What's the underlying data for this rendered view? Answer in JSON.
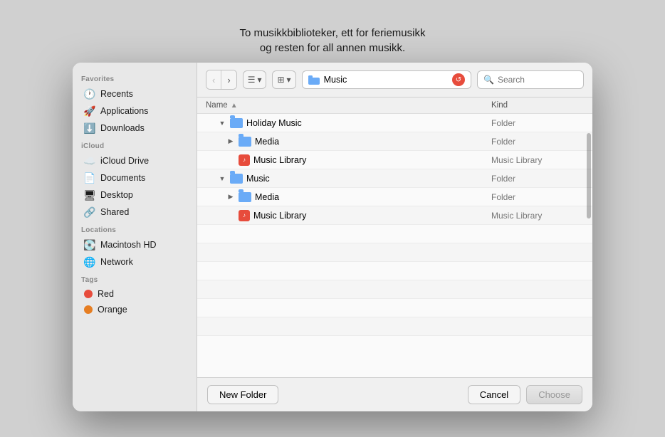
{
  "tooltip": {
    "line1": "To musikkbiblioteker, ett for feriemusikk",
    "line2": "og resten for all annen musikk."
  },
  "sidebar": {
    "favorites_label": "Favorites",
    "icloud_label": "iCloud",
    "locations_label": "Locations",
    "tags_label": "Tags",
    "favorites": [
      {
        "id": "recents",
        "label": "Recents",
        "icon": "🕐",
        "icon_class": "icon-red"
      },
      {
        "id": "applications",
        "label": "Applications",
        "icon": "🚀",
        "icon_class": "icon-red"
      },
      {
        "id": "downloads",
        "label": "Downloads",
        "icon": "⬇️",
        "icon_class": "icon-red"
      }
    ],
    "icloud": [
      {
        "id": "icloud-drive",
        "label": "iCloud Drive",
        "icon": "☁️"
      },
      {
        "id": "documents",
        "label": "Documents",
        "icon": "📄"
      },
      {
        "id": "desktop",
        "label": "Desktop",
        "icon": "🖥"
      },
      {
        "id": "shared",
        "label": "Shared",
        "icon": "🔗"
      }
    ],
    "locations": [
      {
        "id": "macintosh-hd",
        "label": "Macintosh HD",
        "icon": "💽"
      },
      {
        "id": "network",
        "label": "Network",
        "icon": "🌐"
      }
    ],
    "tags": [
      {
        "id": "red",
        "label": "Red",
        "color": "#e74c3c"
      },
      {
        "id": "orange",
        "label": "Orange",
        "color": "#e67e22"
      }
    ]
  },
  "toolbar": {
    "path_name": "Music",
    "search_placeholder": "Search"
  },
  "file_list": {
    "col_name": "Name",
    "col_kind": "Kind",
    "rows": [
      {
        "id": "holiday-music",
        "name": "Holiday Music",
        "kind": "Folder",
        "type": "folder",
        "indent": 0,
        "expanded": true,
        "expand": "▼"
      },
      {
        "id": "holiday-media",
        "name": "Media",
        "kind": "Folder",
        "type": "folder",
        "indent": 1,
        "expanded": false,
        "expand": "▶"
      },
      {
        "id": "holiday-lib",
        "name": "Music Library",
        "kind": "Music Library",
        "type": "library",
        "indent": 1,
        "expand": ""
      },
      {
        "id": "music",
        "name": "Music",
        "kind": "Folder",
        "type": "folder",
        "indent": 0,
        "expanded": true,
        "expand": "▼"
      },
      {
        "id": "music-media",
        "name": "Media",
        "kind": "Folder",
        "type": "folder",
        "indent": 1,
        "expanded": false,
        "expand": "▶"
      },
      {
        "id": "music-lib",
        "name": "Music Library",
        "kind": "Music Library",
        "type": "library",
        "indent": 1,
        "expand": ""
      }
    ]
  },
  "bottom_bar": {
    "new_folder": "New Folder",
    "cancel": "Cancel",
    "choose": "Choose"
  }
}
